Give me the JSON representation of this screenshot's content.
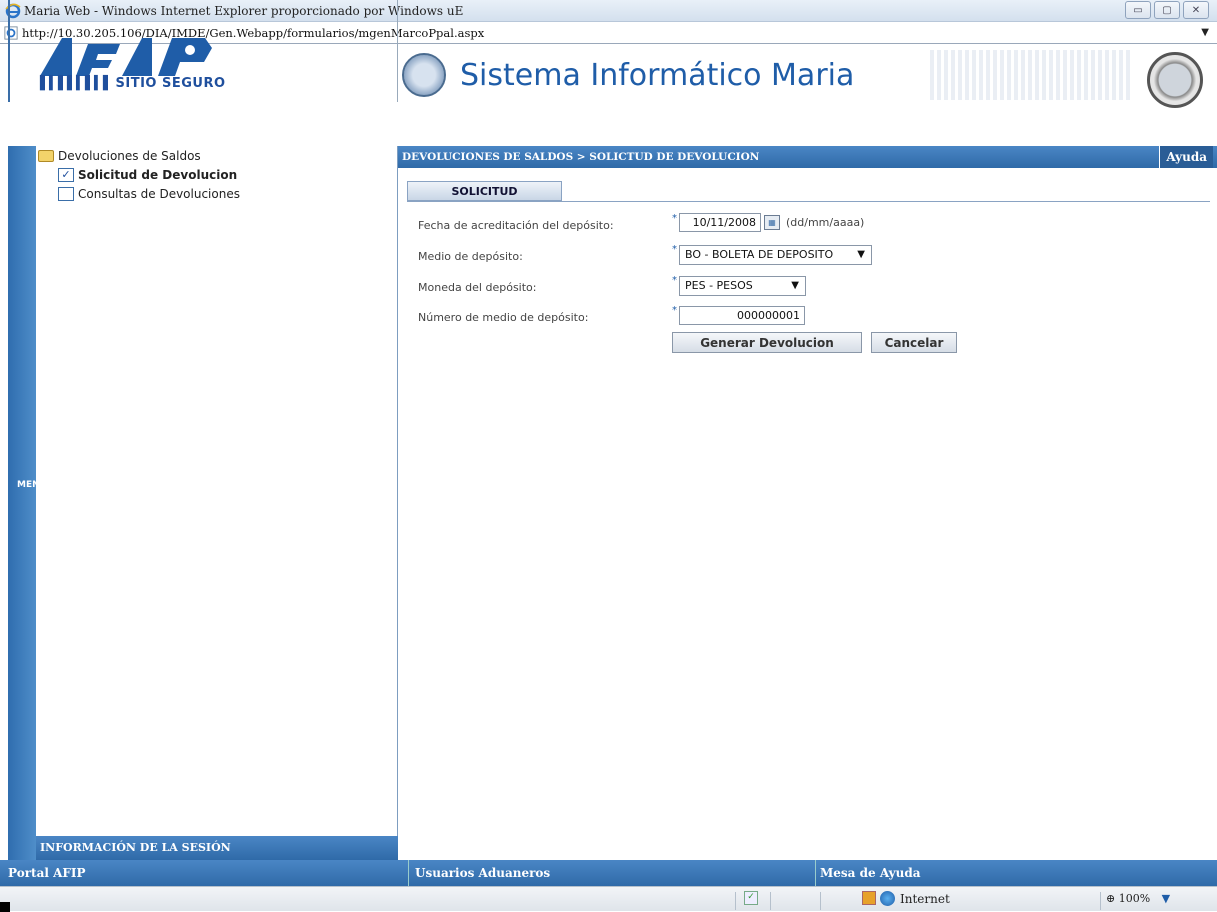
{
  "window": {
    "title": "Maria Web - Windows Internet Explorer proporcionado por Windows uE",
    "url": "http://10.30.205.106/DIA/IMDE/Gen.Webapp/formularios/mgenMarcoPpal.aspx",
    "min_glyph": "▭",
    "max_glyph": "▢",
    "close_glyph": "✕"
  },
  "header": {
    "logo_text": "SITIO SEGURO",
    "system_title": "Sistema Informático Maria"
  },
  "sidebar": {
    "menu_label": "MENU",
    "tree": {
      "root": "Devoluciones de Saldos",
      "items": [
        {
          "label": "Solicitud de Devolucion",
          "checked": true
        },
        {
          "label": "Consultas de Devoluciones",
          "checked": false
        }
      ]
    },
    "session_label": "INFORMACIÓN DE LA SESIÓN"
  },
  "main": {
    "breadcrumb": "DEVOLUCIONES DE SALDOS > SOLICTUD DE DEVOLUCION",
    "help_label": "Ayuda",
    "tab_label": "SOLICITUD",
    "form": {
      "fecha_label": "Fecha de acreditación del depósito:",
      "fecha_value": "10/11/2008",
      "fecha_hint": "(dd/mm/aaaa)",
      "medio_label": "Medio de depósito:",
      "medio_value": "BO - BOLETA DE DEPOSITO",
      "moneda_label": "Moneda del depósito:",
      "moneda_value": "PES - PESOS",
      "numero_label": "Número de medio de depósito:",
      "numero_value": "000000001",
      "required_mark": "*",
      "generar_label": "Generar Devolucion",
      "cancelar_label": "Cancelar"
    }
  },
  "footer": {
    "portal": "Portal AFIP",
    "usuarios": "Usuarios Aduaneros",
    "mesa": "Mesa de Ayuda"
  },
  "statusbar": {
    "zone": "Internet",
    "zoom": "100%"
  },
  "colors": {
    "accent": "#2f6aa8",
    "title_blue": "#1f5da8"
  }
}
